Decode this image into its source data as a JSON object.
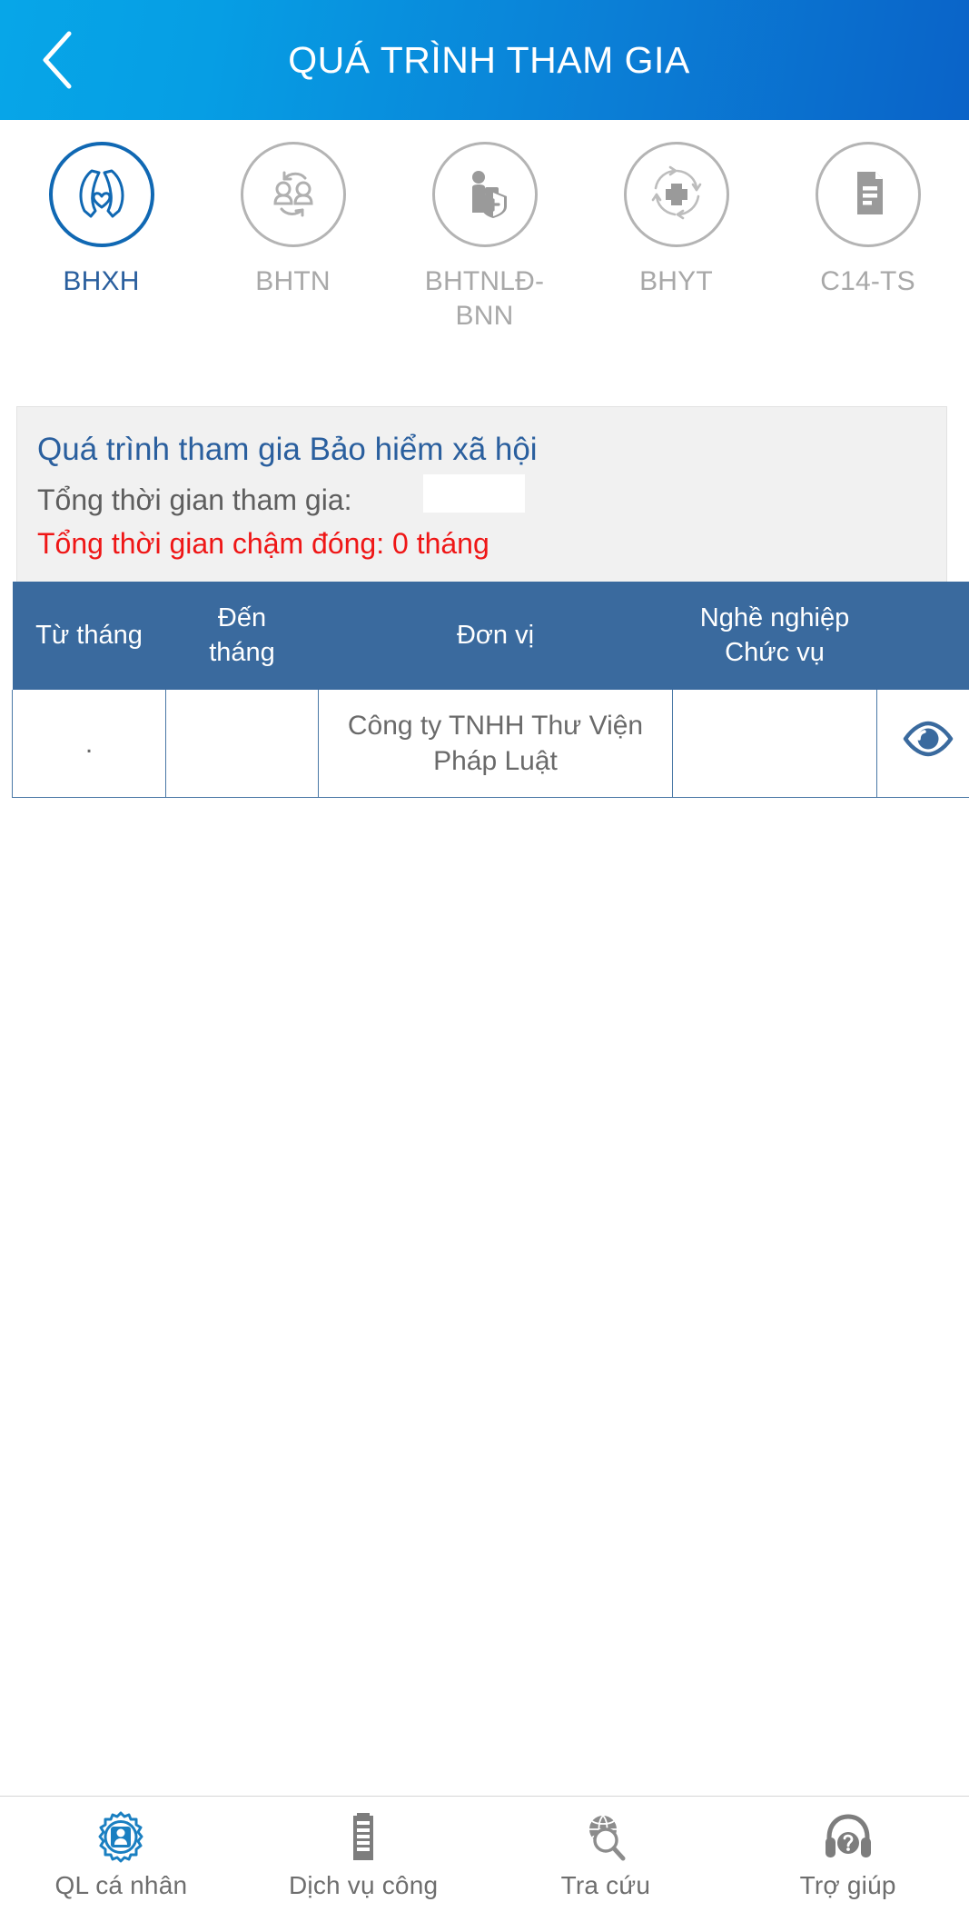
{
  "appbar": {
    "title": "QUÁ TRÌNH THAM GIA",
    "back_icon": "chevron-left-icon",
    "gradient_from": "#07a6e8",
    "gradient_to": "#0a63c8"
  },
  "category_tabs": {
    "active_index": 0,
    "active_color": "#2a5f9e",
    "inactive_color": "#a8a8a8",
    "items": [
      {
        "label": "BHXH",
        "icon": "praying-hands-heart-icon",
        "active": true
      },
      {
        "label": "BHTN",
        "icon": "people-exchange-icon",
        "active": false
      },
      {
        "label": "BHTNLĐ-BNN",
        "icon": "worker-shield-icon",
        "active": false
      },
      {
        "label": "BHYT",
        "icon": "medical-cross-cycle-icon",
        "active": false
      },
      {
        "label": "C14-TS",
        "icon": "document-lines-icon",
        "active": false
      }
    ]
  },
  "info_panel": {
    "title": "Quá trình tham gia Bảo hiểm xã hội",
    "total_time_label": "Tổng thời gian tham gia:",
    "total_time_value": "",
    "late_payment_text": "Tổng thời gian chậm đóng: 0 tháng",
    "title_color": "#2a5f9e",
    "alert_color": "#ef1616",
    "background": "#f1f1f1"
  },
  "table": {
    "header_background": "#3a6a9e",
    "columns": [
      "Từ tháng",
      "Đến\ntháng",
      "Đơn vị",
      "Nghề nghiệp\nChức vụ",
      ""
    ],
    "rows": [
      {
        "from_month": ".",
        "to_month": "",
        "unit": "Công ty TNHH Thư Viện Pháp Luật",
        "job_position": "",
        "action_icon": "eye-icon"
      }
    ]
  },
  "bottom_nav": {
    "active_index": 0,
    "active_color": "#1a7fc1",
    "items": [
      {
        "label": "QL cá nhân",
        "icon": "person-gear-icon",
        "active": true
      },
      {
        "label": "Dịch vụ công",
        "icon": "document-icon",
        "active": false
      },
      {
        "label": "Tra cứu",
        "icon": "globe-search-icon",
        "active": false
      },
      {
        "label": "Trợ giúp",
        "icon": "headset-help-icon",
        "active": false
      }
    ]
  }
}
